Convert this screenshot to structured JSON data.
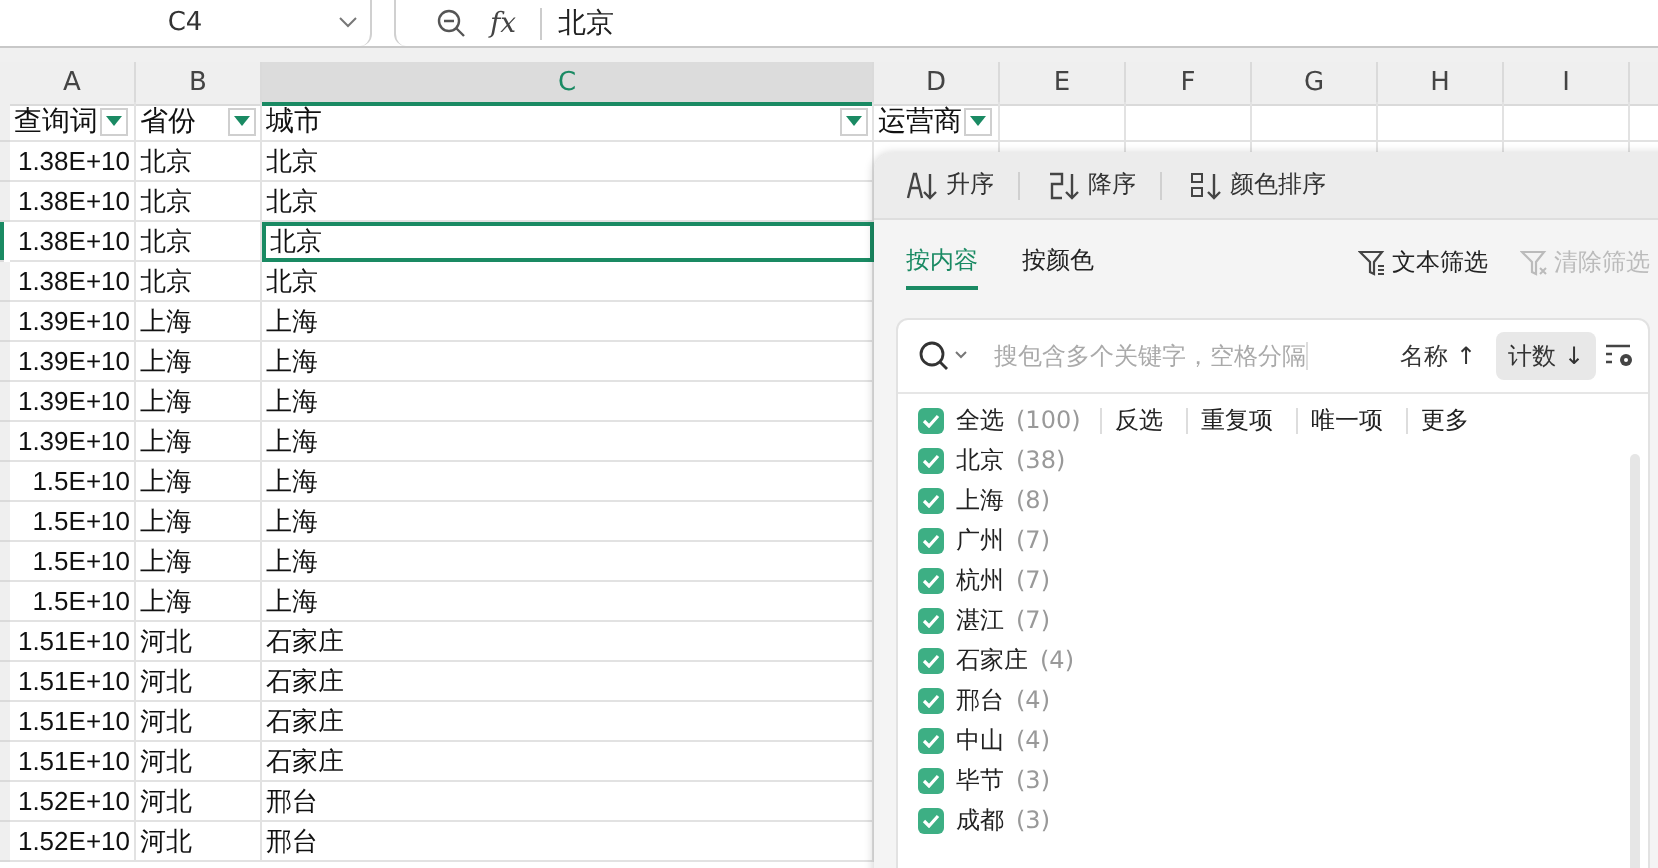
{
  "name_box": {
    "value": "C4"
  },
  "formula_bar": {
    "fx": "fx",
    "value": "北京"
  },
  "columns": [
    {
      "label": "A",
      "selected": false
    },
    {
      "label": "B",
      "selected": false
    },
    {
      "label": "C",
      "selected": true
    },
    {
      "label": "D",
      "selected": false
    },
    {
      "label": "E",
      "selected": false
    },
    {
      "label": "F",
      "selected": false
    },
    {
      "label": "G",
      "selected": false
    },
    {
      "label": "H",
      "selected": false
    },
    {
      "label": "I",
      "selected": false
    }
  ],
  "header_row": [
    {
      "text": "查询词",
      "filter": true
    },
    {
      "text": "省份",
      "filter": true
    },
    {
      "text": "城市",
      "filter": true
    },
    {
      "text": "运营商",
      "filter": true
    }
  ],
  "rows": [
    {
      "cells": [
        "1.38E+10",
        "北京",
        "北京"
      ],
      "selected": false
    },
    {
      "cells": [
        "1.38E+10",
        "北京",
        "北京"
      ],
      "selected": false
    },
    {
      "cells": [
        "1.38E+10",
        "北京",
        "北京"
      ],
      "selected": true
    },
    {
      "cells": [
        "1.38E+10",
        "北京",
        "北京"
      ],
      "selected": false
    },
    {
      "cells": [
        "1.39E+10",
        "上海",
        "上海"
      ],
      "selected": false
    },
    {
      "cells": [
        "1.39E+10",
        "上海",
        "上海"
      ],
      "selected": false
    },
    {
      "cells": [
        "1.39E+10",
        "上海",
        "上海"
      ],
      "selected": false
    },
    {
      "cells": [
        "1.39E+10",
        "上海",
        "上海"
      ],
      "selected": false
    },
    {
      "cells": [
        "1.5E+10",
        "上海",
        "上海"
      ],
      "selected": false
    },
    {
      "cells": [
        "1.5E+10",
        "上海",
        "上海"
      ],
      "selected": false
    },
    {
      "cells": [
        "1.5E+10",
        "上海",
        "上海"
      ],
      "selected": false
    },
    {
      "cells": [
        "1.5E+10",
        "上海",
        "上海"
      ],
      "selected": false
    },
    {
      "cells": [
        "1.51E+10",
        "河北",
        "石家庄"
      ],
      "selected": false
    },
    {
      "cells": [
        "1.51E+10",
        "河北",
        "石家庄"
      ],
      "selected": false
    },
    {
      "cells": [
        "1.51E+10",
        "河北",
        "石家庄"
      ],
      "selected": false
    },
    {
      "cells": [
        "1.51E+10",
        "河北",
        "石家庄"
      ],
      "selected": false
    },
    {
      "cells": [
        "1.52E+10",
        "河北",
        "邢台"
      ],
      "selected": false
    },
    {
      "cells": [
        "1.52E+10",
        "河北",
        "邢台"
      ],
      "selected": false
    }
  ],
  "filter_panel": {
    "sort_buttons": [
      {
        "kind": "asc",
        "label": "升序"
      },
      {
        "kind": "desc",
        "label": "降序"
      },
      {
        "kind": "color",
        "label": "颜色排序"
      }
    ],
    "tabs": [
      {
        "label": "按内容",
        "selected": true
      },
      {
        "label": "按颜色",
        "selected": false
      }
    ],
    "actions": [
      {
        "label": "文本筛选",
        "disabled": false
      },
      {
        "label": "清除筛选",
        "disabled": true
      }
    ],
    "search": {
      "placeholder": "搜包含多个关键字，空格分隔"
    },
    "sort_toggles": [
      {
        "label": "名称",
        "arrow": "↑",
        "selected": false
      },
      {
        "label": "计数",
        "arrow": "↓",
        "selected": true
      }
    ],
    "select_all": {
      "label": "全选",
      "count": "(100)",
      "checked": true
    },
    "quick_links": [
      "反选",
      "重复项",
      "唯一项",
      "更多"
    ],
    "items": [
      {
        "label": "北京",
        "count": "(38)",
        "checked": true
      },
      {
        "label": "上海",
        "count": "(8)",
        "checked": true
      },
      {
        "label": "广州",
        "count": "(7)",
        "checked": true
      },
      {
        "label": "杭州",
        "count": "(7)",
        "checked": true
      },
      {
        "label": "湛江",
        "count": "(7)",
        "checked": true
      },
      {
        "label": "石家庄",
        "count": "(4)",
        "checked": true
      },
      {
        "label": "邢台",
        "count": "(4)",
        "checked": true
      },
      {
        "label": "中山",
        "count": "(4)",
        "checked": true
      },
      {
        "label": "毕节",
        "count": "(3)",
        "checked": true
      },
      {
        "label": "成都",
        "count": "(3)",
        "checked": true
      }
    ]
  }
}
